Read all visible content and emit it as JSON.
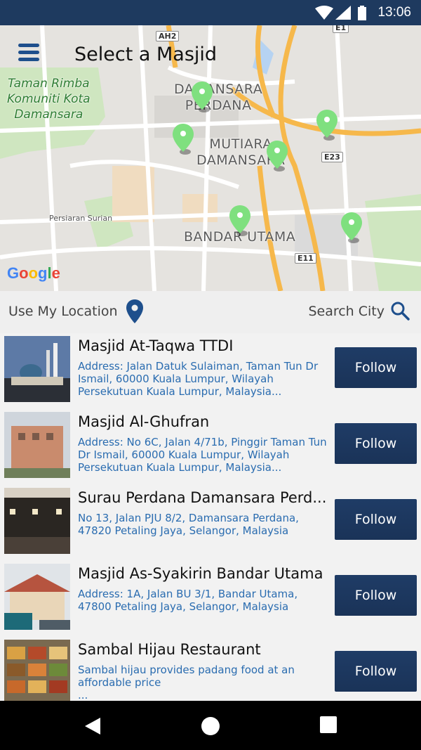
{
  "status_bar": {
    "time": "13:06",
    "icons": [
      "wifi-icon",
      "signal-icon",
      "battery-icon"
    ]
  },
  "header": {
    "title": "Select a Masjid",
    "menu_icon": "hamburger-menu-icon"
  },
  "map": {
    "labels": {
      "park": "Taman Rimba\nKomuniti Kota\nDamansara",
      "damansara_perdana": "DAMANSARA\nPERDANA",
      "mutiara_damansara": "MUTIARA\nDAMANSARA",
      "bandar_utama": "BANDAR UTAMA",
      "persiaran_surian": "Persiaran Surian",
      "ah2": "AH2",
      "e23": "E23",
      "e11": "E11",
      "e1": "E1"
    },
    "attribution": "Google",
    "pin_color": "#7fe07f"
  },
  "controls": {
    "use_my_location": "Use My Location",
    "search_city": "Search City",
    "accent": "#1e4f8c"
  },
  "items": [
    {
      "name": "Masjid At-Taqwa TTDI",
      "description": "Address: Jalan Datuk Sulaiman, Taman Tun Dr Ismail, 60000 Kuala Lumpur, Wilayah Persekutuan Kuala Lumpur, Malaysia...",
      "button": "Follow"
    },
    {
      "name": "Masjid Al-Ghufran",
      "description": "Address: No 6C, Jalan 4/71b,  Pinggir Taman Tun Dr Ismail, 60000 Kuala Lumpur, Wilayah Persekutuan Kuala Lumpur, Malaysia...",
      "button": "Follow"
    },
    {
      "name": "Surau Perdana Damansara Perd...",
      "description": "No 13, Jalan PJU 8/2, Damansara Perdana, 47820 Petaling Jaya, Selangor, Malaysia",
      "button": "Follow"
    },
    {
      "name": "Masjid As-Syakirin Bandar Utama",
      "description": "Address: 1A, Jalan BU 3/1, Bandar Utama, 47800 Petaling Jaya, Selangor, Malaysia",
      "button": "Follow"
    },
    {
      "name": "Sambal Hijau Restaurant",
      "description": "Sambal hijau provides padang food at an affordable price\n...",
      "button": "Follow"
    }
  ],
  "nav": {
    "icons": [
      "back-icon",
      "home-icon",
      "recents-icon"
    ]
  }
}
